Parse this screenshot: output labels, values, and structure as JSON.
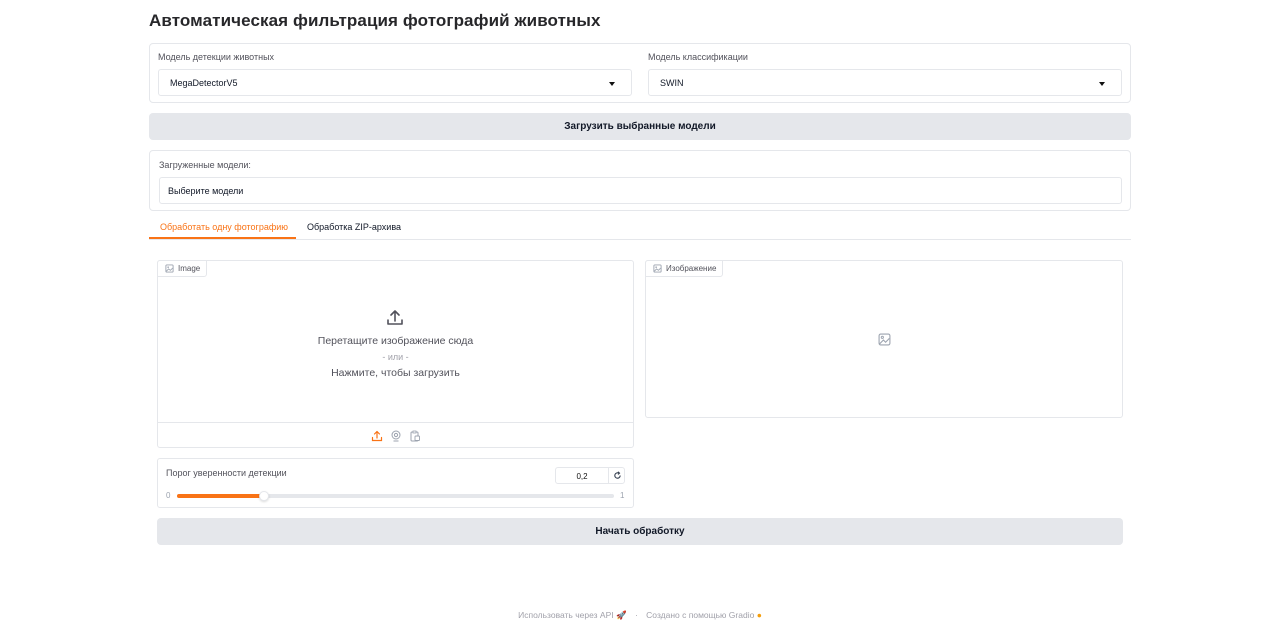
{
  "app_title": "Автоматическая фильтрация фотографий животных",
  "models": {
    "detection": {
      "label": "Модель детекции животных",
      "value": "MegaDetectorV5"
    },
    "classification": {
      "label": "Модель классификации",
      "value": "SWIN"
    }
  },
  "load_button_label": "Загрузить выбранные модели",
  "loaded": {
    "label": "Загруженные модели:",
    "value": "Выберите модели"
  },
  "tabs": [
    {
      "label": "Обработать одну фотографию",
      "active": true
    },
    {
      "label": "Обработка ZIP-архива",
      "active": false
    }
  ],
  "input_image": {
    "tag": "Image",
    "drop_text": "Перетащите изображение сюда",
    "or_text": "- или -",
    "click_text": "Нажмите, чтобы загрузить"
  },
  "output_image": {
    "tag": "Изображение"
  },
  "threshold": {
    "label": "Порог уверенности детекции",
    "value": "0,2",
    "min_label": "0",
    "max_label": "1",
    "fraction": 0.2
  },
  "start_button_label": "Начать обработку",
  "footer": {
    "api": "Использовать через API",
    "dot": "·",
    "built": "Создано с помощью Gradio"
  },
  "colors": {
    "accent": "#f97316",
    "button_bg": "#e5e7eb",
    "border": "#e5e7eb"
  }
}
